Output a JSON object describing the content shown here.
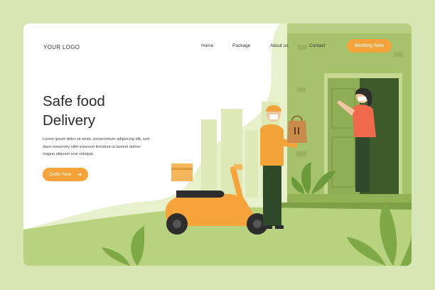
{
  "brand": {
    "logo": "YOUR LOGO"
  },
  "nav": {
    "items": [
      "Home",
      "Package",
      "About us",
      "Contact"
    ],
    "cta": "Booking Now"
  },
  "hero": {
    "title_line1": "Safe food",
    "title_line2": "Delivery",
    "body_lines": [
      "Lorem ipsum dolor sit amet, consectetuer adipiscing elit, sed",
      "diam nonummy nibh euismod tincidunt ut laoreet dolore",
      "magna aliquam erat volutpat."
    ],
    "cta": "Order Now",
    "cta_icon": "arrow-right-icon"
  },
  "colors": {
    "page_bg": "#d6e6b4",
    "card_bg": "#ffffff",
    "accent": "#f5a33a",
    "green_light": "#e7efc9",
    "green_wall": "#a7c26d",
    "green_dark": "#6b8a3a"
  }
}
